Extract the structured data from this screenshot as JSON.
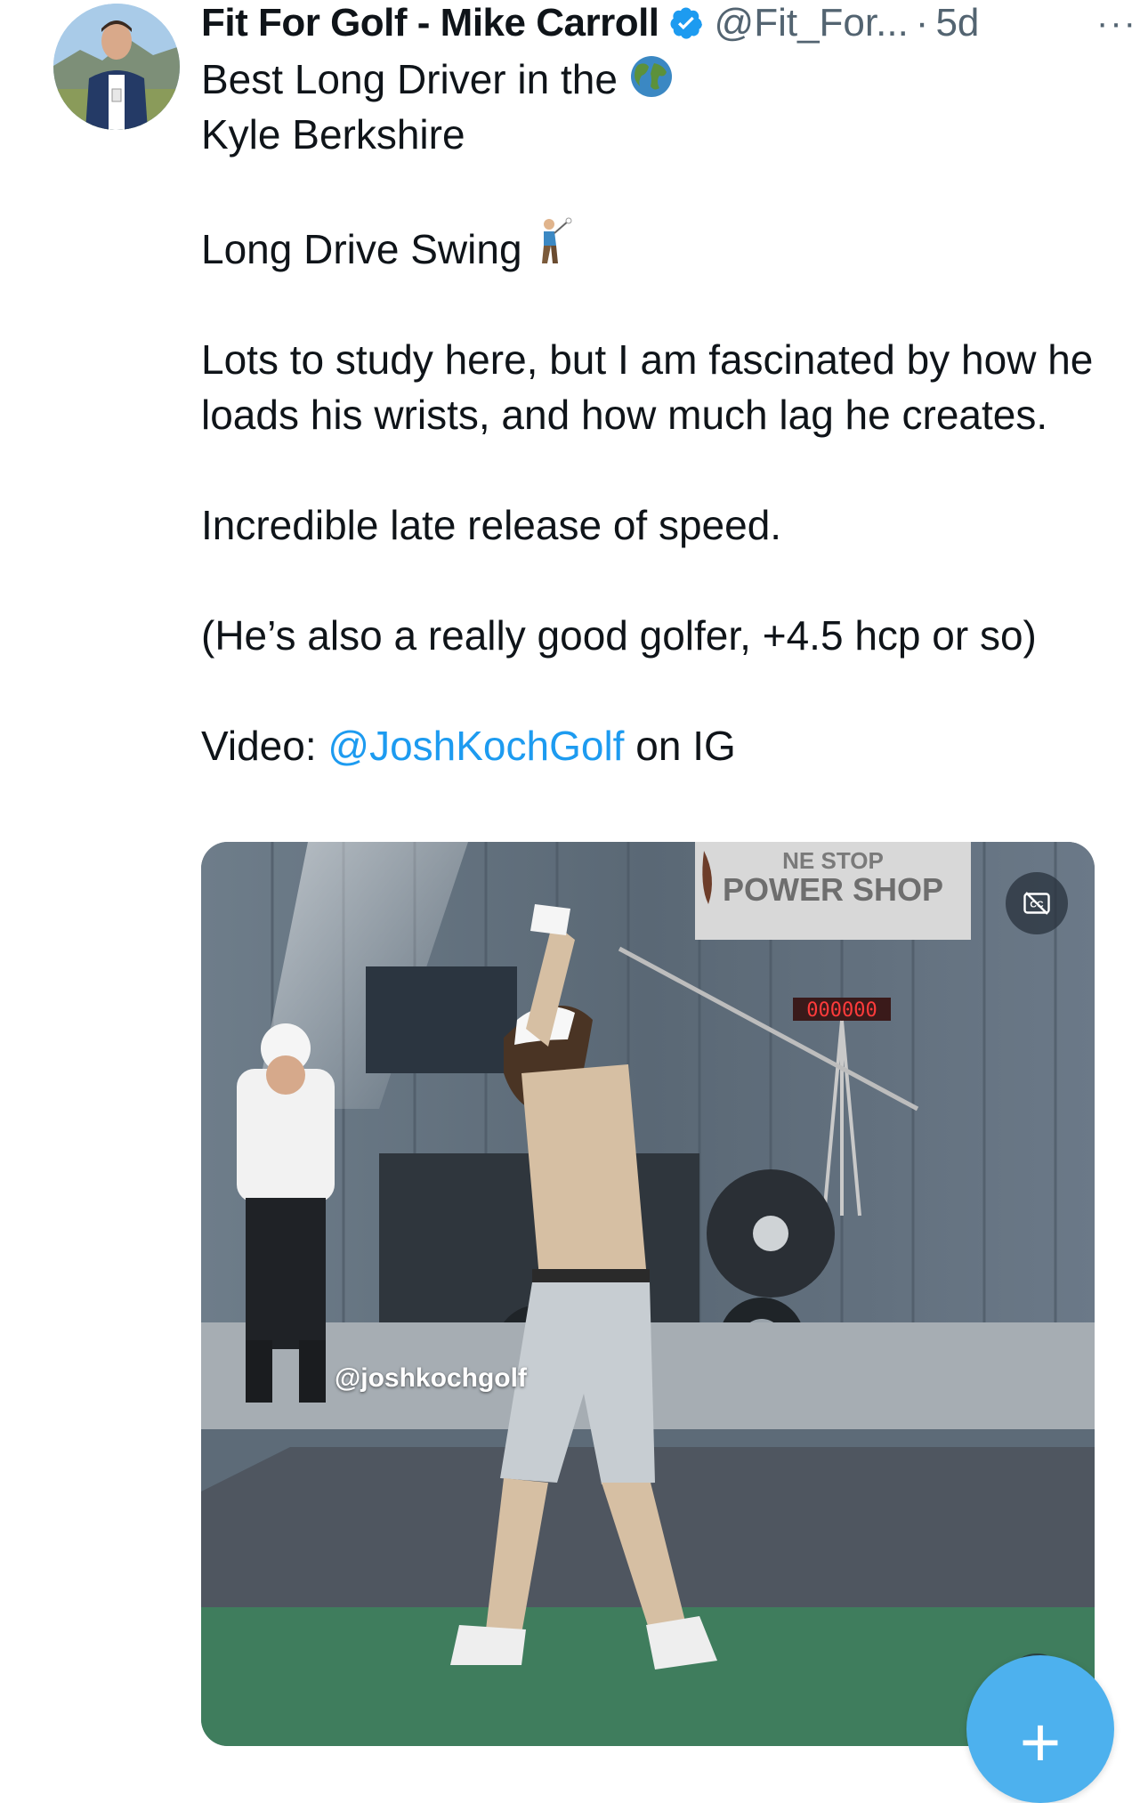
{
  "author": {
    "name": "Fit For Golf - Mike Carroll",
    "handle": "@Fit_For...",
    "separator": "·",
    "time": "5d",
    "avatar_icon": "profile-photo"
  },
  "more_label": "···",
  "tweet": {
    "line1": "Best Long Driver in the",
    "line1_emoji": "globe-emoji",
    "line2": "Kyle Berkshire",
    "line3": "Long Drive Swing",
    "line3_emoji": "golfer-emoji",
    "para1": "Lots to study here, but I am fascinated by how he loads his wrists, and how much lag he creates.",
    "para2": "Incredible late release of speed.",
    "para3": "(He’s also a really good golfer, +4.5 hcp or so)",
    "video_prefix": "Video: ",
    "video_mention": "@JoshKochGolf",
    "video_suffix": " on IG"
  },
  "media": {
    "sign_line1": "NE STOP",
    "sign_line2": "POWER SHOP",
    "led_text": "000000",
    "watermark": "@joshkochgolf",
    "cc_icon": "captions-off-icon",
    "mute_icon": "speaker-muted-icon"
  },
  "fab": {
    "label": "+",
    "icon": "compose-plus-icon"
  },
  "colors": {
    "link": "#1d9bf0",
    "verified": "#1d9bf0",
    "fab": "#4db1ee"
  }
}
